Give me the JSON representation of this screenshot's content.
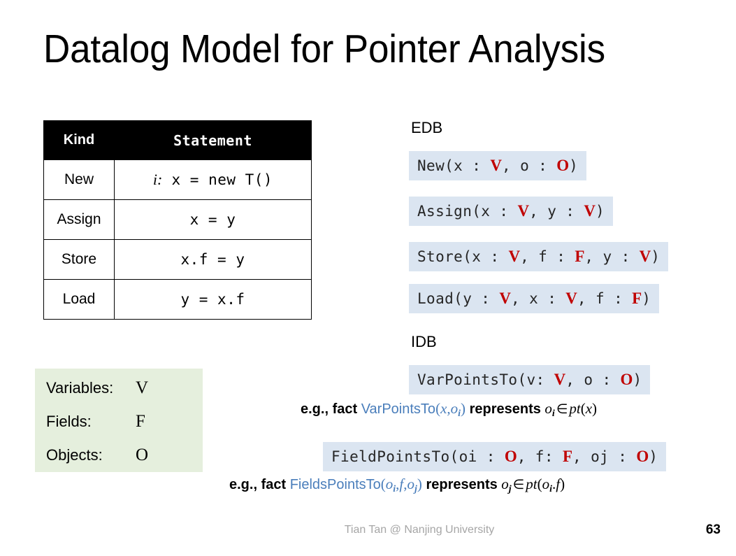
{
  "slide": {
    "title": "Datalog Model for Pointer Analysis",
    "page_number": "63",
    "credit": "Tian Tan @ Nanjing University"
  },
  "colors": {
    "predicate_highlight": "#dbe5f1",
    "legend_box": "#e5efdd",
    "type_red": "#c00000",
    "link_blue": "#4a7ebb",
    "header_black": "#000000",
    "credit_gray": "#a6a6a6"
  },
  "statement_table": {
    "headers": [
      "Kind",
      "Statement"
    ],
    "rows": [
      {
        "kind": "New",
        "index": "i:",
        "statement": " x = new T()"
      },
      {
        "kind": "Assign",
        "index": "",
        "statement": "x = y"
      },
      {
        "kind": "Store",
        "index": "",
        "statement": "x.f = y"
      },
      {
        "kind": "Load",
        "index": "",
        "statement": "y = x.f"
      }
    ]
  },
  "legend": {
    "rows": [
      {
        "label": "Variables:",
        "symbol": "V"
      },
      {
        "label": "Fields:",
        "symbol": "F"
      },
      {
        "label": "Objects:",
        "symbol": "O"
      }
    ]
  },
  "edb": {
    "label": "EDB",
    "predicates": [
      {
        "name": "New",
        "parts": [
          {
            "t": "New(x : ",
            "k": "plain"
          },
          {
            "t": "V",
            "k": "type"
          },
          {
            "t": ", o : ",
            "k": "plain"
          },
          {
            "t": "O",
            "k": "type"
          },
          {
            "t": ")",
            "k": "plain"
          }
        ]
      },
      {
        "name": "Assign",
        "parts": [
          {
            "t": "Assign(x : ",
            "k": "plain"
          },
          {
            "t": "V",
            "k": "type"
          },
          {
            "t": ", y : ",
            "k": "plain"
          },
          {
            "t": "V",
            "k": "type"
          },
          {
            "t": ")",
            "k": "plain"
          }
        ]
      },
      {
        "name": "Store",
        "parts": [
          {
            "t": "Store(x : ",
            "k": "plain"
          },
          {
            "t": "V",
            "k": "type"
          },
          {
            "t": ", f : ",
            "k": "plain"
          },
          {
            "t": "F",
            "k": "type"
          },
          {
            "t": ", y : ",
            "k": "plain"
          },
          {
            "t": "V",
            "k": "type"
          },
          {
            "t": ")",
            "k": "plain"
          }
        ]
      },
      {
        "name": "Load",
        "parts": [
          {
            "t": "Load(y : ",
            "k": "plain"
          },
          {
            "t": "V",
            "k": "type"
          },
          {
            "t": ", x : ",
            "k": "plain"
          },
          {
            "t": "V",
            "k": "type"
          },
          {
            "t": ", f : ",
            "k": "plain"
          },
          {
            "t": "F",
            "k": "type"
          },
          {
            "t": ")",
            "k": "plain"
          }
        ]
      }
    ]
  },
  "idb": {
    "label": "IDB",
    "predicates": [
      {
        "name": "VarPointsTo",
        "parts": [
          {
            "t": "VarPointsTo(v: ",
            "k": "plain"
          },
          {
            "t": "V",
            "k": "type"
          },
          {
            "t": ", o : ",
            "k": "plain"
          },
          {
            "t": "O",
            "k": "type"
          },
          {
            "t": ")",
            "k": "plain"
          }
        ]
      },
      {
        "name": "FieldPointsTo",
        "parts": [
          {
            "t": "FieldPointsTo(oi : ",
            "k": "plain"
          },
          {
            "t": "O",
            "k": "type"
          },
          {
            "t": ", f: ",
            "k": "plain"
          },
          {
            "t": "F",
            "k": "type"
          },
          {
            "t": ", oj : ",
            "k": "plain"
          },
          {
            "t": "O",
            "k": "type"
          },
          {
            "t": ")",
            "k": "plain"
          }
        ]
      }
    ]
  },
  "examples": {
    "var_points_to": {
      "prefix": "e.g., fact ",
      "predicate": "VarPointsTo",
      "args_open": "(",
      "arg1": "x",
      "comma": ",",
      "arg2_base": "o",
      "arg2_sub": "i",
      "args_close": ")",
      "middle": " represents ",
      "elem_base": "o",
      "elem_sub": "i",
      "member": "∈",
      "fn": "pt",
      "fn_open": "(",
      "fn_arg": "x",
      "fn_close": ")"
    },
    "field_points_to": {
      "prefix": "e.g., fact ",
      "predicate": "FieldsPointsTo",
      "args_open": "(",
      "arg1_base": "o",
      "arg1_sub": "i",
      "comma1": ",",
      "arg2": "f",
      "comma2": ",",
      "arg3_base": "o",
      "arg3_sub": "j",
      "args_close": ")",
      "middle": " represents ",
      "elem_base": "o",
      "elem_sub": "j",
      "member": "∈",
      "fn": "pt",
      "fn_open": "(",
      "fn_arg_base": "o",
      "fn_arg_sub": "i",
      "fn_dot": ".",
      "fn_arg2": "f",
      "fn_close": ")"
    }
  }
}
